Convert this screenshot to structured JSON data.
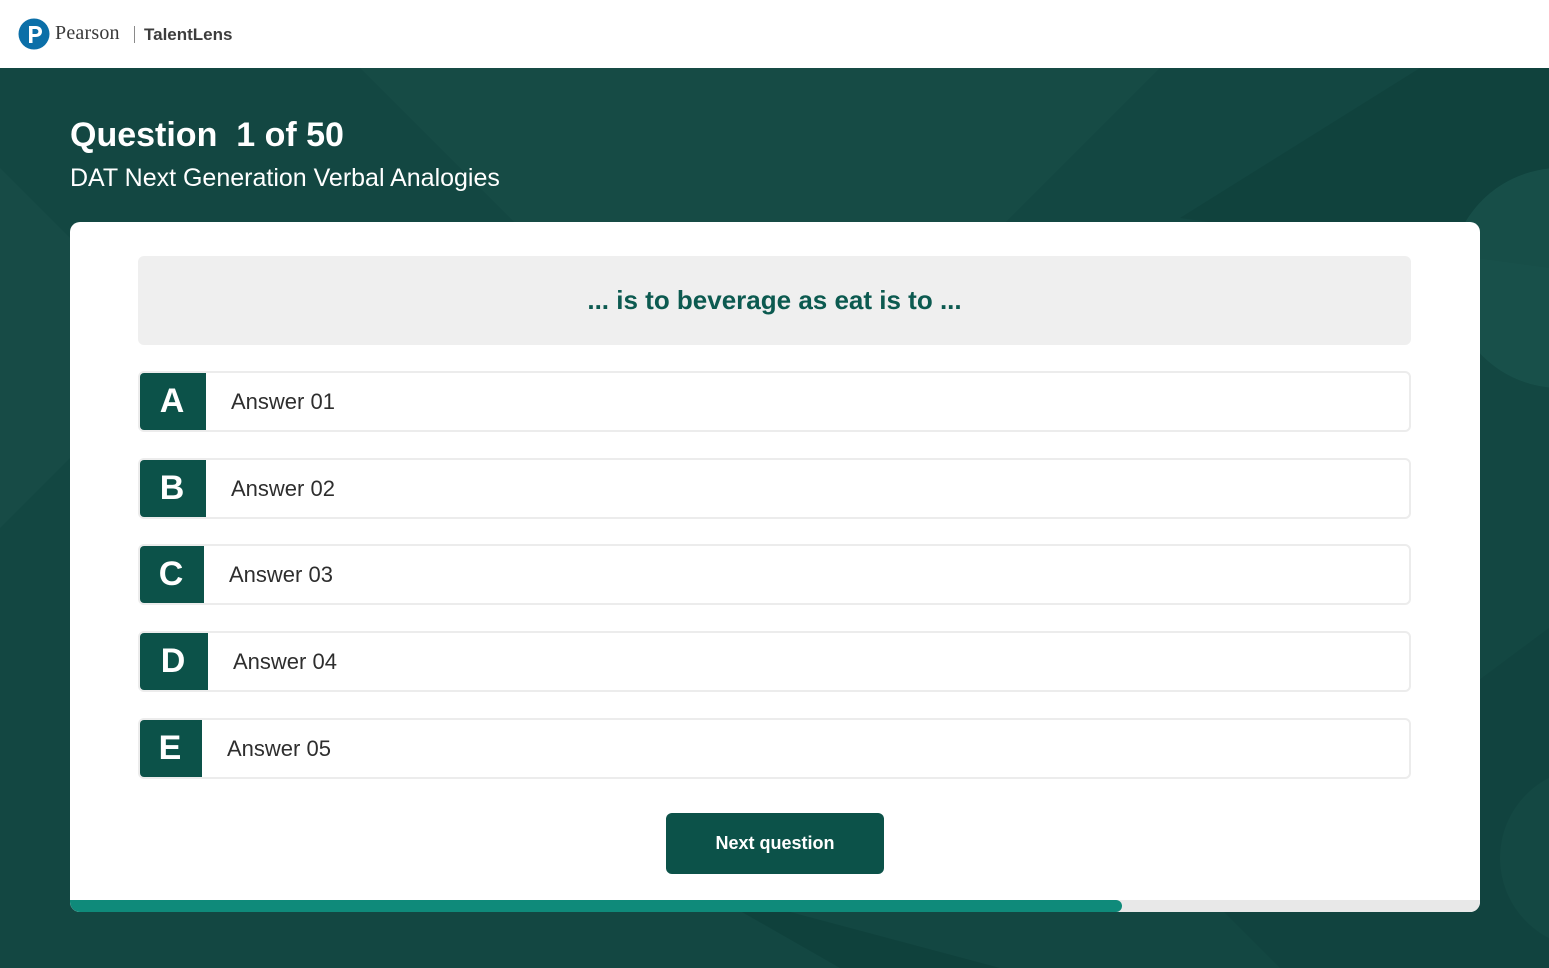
{
  "header": {
    "brand": "Pearson",
    "product": "TalentLens",
    "logo_icon": "pearson-p-logo-icon"
  },
  "colors": {
    "brand_teal": "#0c5249",
    "background": "#134742",
    "progress": "#0f8a7a",
    "prompt_text": "#0c5a50"
  },
  "question": {
    "title": "Question  1 of 50",
    "test_name": "DAT Next Generation Verbal Analogies",
    "prompt": "... is to beverage as eat is to ..."
  },
  "options": [
    {
      "letter": "A",
      "label": "Answer 01"
    },
    {
      "letter": "B",
      "label": "Answer 02"
    },
    {
      "letter": "C",
      "label": "Answer 03"
    },
    {
      "letter": "D",
      "label": "Answer 04"
    },
    {
      "letter": "E",
      "label": "Answer 05"
    }
  ],
  "actions": {
    "next_label": "Next question"
  },
  "progress": {
    "fraction": 0.746
  }
}
